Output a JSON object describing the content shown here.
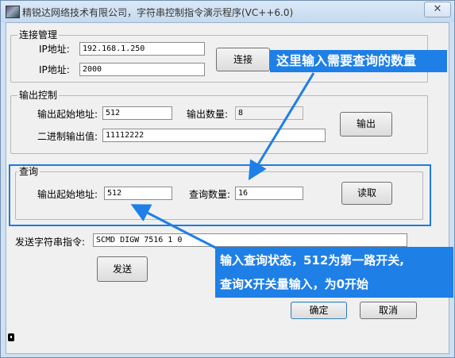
{
  "window": {
    "title": "精锐达网络技术有限公司，字符串控制指令演示程序(VC++6.0)",
    "close_glyph": "✕"
  },
  "connect_group": {
    "title": "连接管理",
    "ip_label": "IP地址:",
    "ip_value": "192.168.1.250",
    "port_label": "IP地址:",
    "port_value": "2000",
    "connect_button": "连接"
  },
  "output_group": {
    "title": "输出控制",
    "start_label": "输出起始地址:",
    "start_value": "512",
    "count_label": "输出数量:",
    "count_value": "8",
    "binary_label": "二进制输出值:",
    "binary_value": "11112222",
    "output_button": "输出"
  },
  "query_group": {
    "title": "查询",
    "start_label": "输出起始地址:",
    "start_value": "512",
    "count_label": "查询数量:",
    "count_value": "16",
    "read_button": "读取"
  },
  "command": {
    "label": "发送字符串指令:",
    "value": "SCMD DIGW 7516 1 0",
    "send_button": "发送"
  },
  "dialog_buttons": {
    "ok": "确定",
    "cancel": "取消"
  },
  "annotations": {
    "callout_top": "这里输入需要查询的数量",
    "callout_bottom_line1": "输入查询状态，512为第一路开关,",
    "callout_bottom_line2": "查询X开关量输入，为0开始"
  },
  "colors": {
    "accent": "#1e7fe6",
    "highlight_border": "#1e7be0"
  }
}
